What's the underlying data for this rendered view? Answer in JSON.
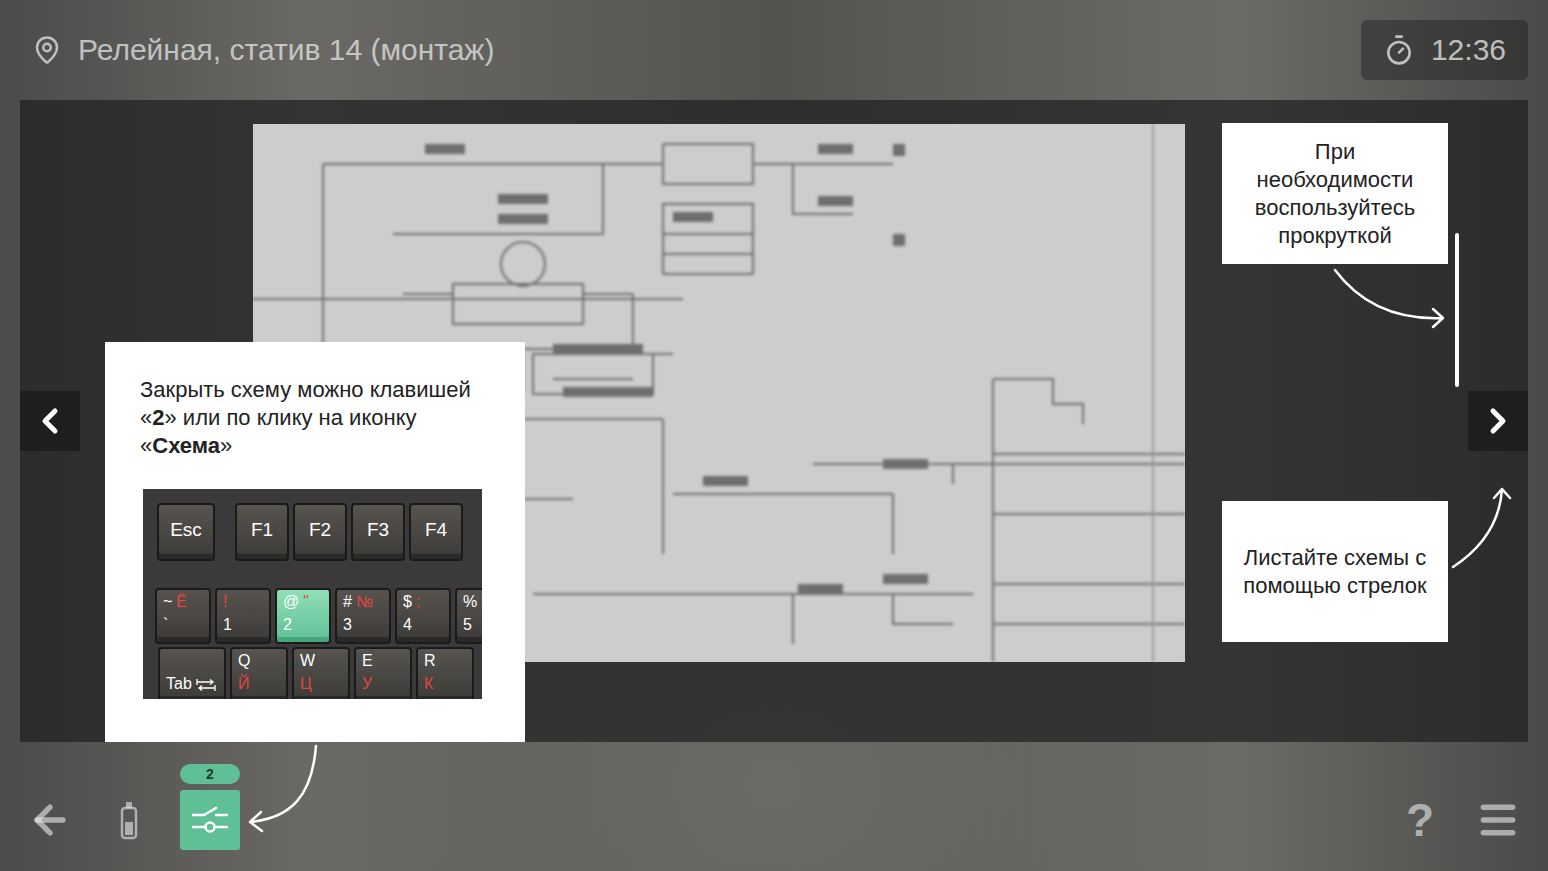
{
  "location": {
    "text": "Релейная, статив 14 (монтаж)"
  },
  "timer": {
    "text": "12:36"
  },
  "hints": {
    "close": {
      "segments": [
        {
          "text": "Закрыть схему можно клавишей «",
          "bold": false
        },
        {
          "text": "2",
          "bold": true
        },
        {
          "text": "» или по клику на иконку «",
          "bold": false
        },
        {
          "text": "Схема",
          "bold": true
        },
        {
          "text": "»",
          "bold": false
        }
      ],
      "keyboard": {
        "rows": [
          {
            "keys": [
              {
                "kind": "single",
                "top": [
                  {
                    "text": "Esc",
                    "red": false
                  }
                ],
                "bottom": [],
                "selected": false
              },
              {
                "kind": "fn",
                "top": [
                  {
                    "text": "F1",
                    "red": false
                  }
                ],
                "bottom": [],
                "selected": false
              },
              {
                "kind": "fn",
                "top": [
                  {
                    "text": "F2",
                    "red": false
                  }
                ],
                "bottom": [],
                "selected": false
              },
              {
                "kind": "fn",
                "top": [
                  {
                    "text": "F3",
                    "red": false
                  }
                ],
                "bottom": [],
                "selected": false
              },
              {
                "kind": "fn",
                "top": [
                  {
                    "text": "F4",
                    "red": false
                  }
                ],
                "bottom": [],
                "selected": false
              }
            ]
          },
          {
            "keys": [
              {
                "kind": "dual",
                "top": [
                  {
                    "text": "~",
                    "red": false
                  },
                  {
                    "text": "Ё",
                    "red": true
                  }
                ],
                "bottom": [
                  {
                    "text": "`",
                    "red": false
                  }
                ],
                "selected": false
              },
              {
                "kind": "dual",
                "top": [
                  {
                    "text": "!",
                    "red": true
                  }
                ],
                "bottom": [
                  {
                    "text": "1",
                    "red": false
                  }
                ],
                "selected": false
              },
              {
                "kind": "dual",
                "top": [
                  {
                    "text": "@",
                    "red": false
                  },
                  {
                    "text": "\"",
                    "red": true
                  }
                ],
                "bottom": [
                  {
                    "text": "2",
                    "red": false
                  }
                ],
                "selected": true
              },
              {
                "kind": "dual",
                "top": [
                  {
                    "text": "#",
                    "red": false
                  },
                  {
                    "text": "№",
                    "red": true
                  }
                ],
                "bottom": [
                  {
                    "text": "3",
                    "red": false
                  }
                ],
                "selected": false
              },
              {
                "kind": "dual",
                "top": [
                  {
                    "text": "$",
                    "red": false
                  },
                  {
                    "text": ";",
                    "red": true
                  }
                ],
                "bottom": [
                  {
                    "text": "4",
                    "red": false
                  }
                ],
                "selected": false
              },
              {
                "kind": "dual",
                "top": [
                  {
                    "text": "%",
                    "red": false
                  }
                ],
                "bottom": [
                  {
                    "text": "5",
                    "red": false
                  }
                ],
                "selected": false
              }
            ]
          },
          {
            "keys": [
              {
                "kind": "tab",
                "top": [],
                "bottom": [
                  {
                    "text": "Tab",
                    "red": false
                  }
                ],
                "selected": false
              },
              {
                "kind": "dual",
                "top": [
                  {
                    "text": "Q",
                    "red": false
                  }
                ],
                "bottom": [
                  {
                    "text": "Й",
                    "red": true
                  }
                ],
                "selected": false
              },
              {
                "kind": "dual",
                "top": [
                  {
                    "text": "W",
                    "red": false
                  }
                ],
                "bottom": [
                  {
                    "text": "Ц",
                    "red": true
                  }
                ],
                "selected": false
              },
              {
                "kind": "dual",
                "top": [
                  {
                    "text": "E",
                    "red": false
                  }
                ],
                "bottom": [
                  {
                    "text": "У",
                    "red": true
                  }
                ],
                "selected": false
              },
              {
                "kind": "dual",
                "top": [
                  {
                    "text": "R",
                    "red": false
                  }
                ],
                "bottom": [
                  {
                    "text": "К",
                    "red": true
                  }
                ],
                "selected": false
              }
            ]
          }
        ]
      }
    },
    "scroll": {
      "text": "При необходимости воспользуйтесь прокруткой"
    },
    "arrows": {
      "text": "Листайте схемы с помощью стрелок"
    }
  },
  "scheme_button": {
    "badge": "2",
    "selected": true
  },
  "help_button": {
    "label": "?"
  }
}
